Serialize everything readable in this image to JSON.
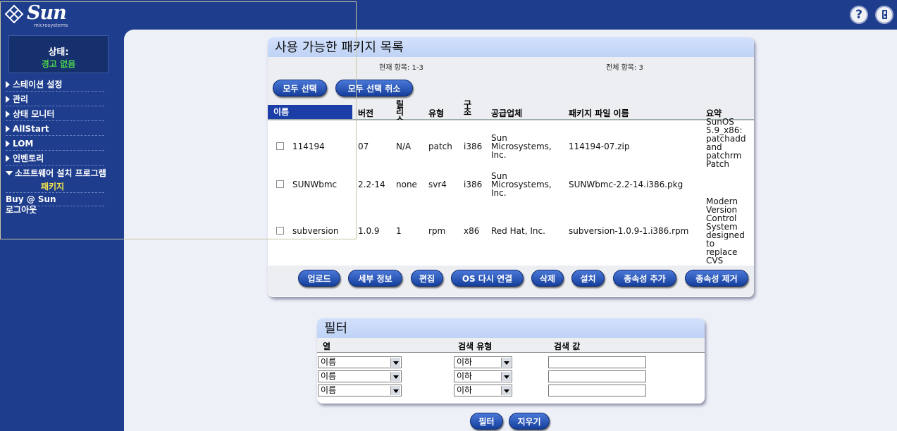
{
  "header": {
    "brand": "Sun",
    "brand_sub": "microsystems",
    "help_label": "?"
  },
  "sidebar": {
    "status_label": "상태:",
    "status_value": "경고 없음",
    "items": [
      {
        "label": "스테이션 설정"
      },
      {
        "label": "관리"
      },
      {
        "label": "상태 모니터"
      },
      {
        "label": "AllStart"
      },
      {
        "label": "LOM"
      },
      {
        "label": "인벤토리"
      },
      {
        "label": "소프트웨어 설치 프로그램"
      }
    ],
    "subitem": "패키지",
    "plain_items": [
      {
        "label": "Buy @ Sun"
      },
      {
        "label": "로그아웃"
      }
    ]
  },
  "packages": {
    "title": "사용 가능한 패키지 목록",
    "current_items": "현재 항목: 1-3",
    "total_items": "전체 항목: 3",
    "select_all": "모두 선택",
    "deselect_all": "모두 선택 취소",
    "columns": {
      "name": "이름",
      "version": "버전",
      "release": "릴리스",
      "type": "유형",
      "arch": "구조",
      "vendor": "공급업체",
      "file": "패키지 파일 이름",
      "summary": "요약"
    },
    "rows": [
      {
        "name": "114194",
        "version": "07",
        "release": "N/A",
        "type": "patch",
        "arch": "i386",
        "vendor": [
          "Sun",
          "Microsystems,",
          "Inc."
        ],
        "file": "114194-07.zip",
        "summary": [
          "SunOS",
          "5.9_x86:",
          "patchadd",
          "and",
          "patchrm",
          "Patch"
        ]
      },
      {
        "name": "SUNWbmc",
        "version": "2.2-14",
        "release": "none",
        "type": "svr4",
        "arch": "i386",
        "vendor": [
          "Sun",
          "Microsystems,",
          "Inc."
        ],
        "file": "SUNWbmc-2.2-14.i386.pkg",
        "summary": []
      },
      {
        "name": "subversion",
        "version": "1.0.9",
        "release": "1",
        "type": "rpm",
        "arch": "x86",
        "vendor": [
          "Red Hat, Inc."
        ],
        "file": "subversion-1.0.9-1.i386.rpm",
        "summary": [
          "Modern",
          "Version",
          "Control",
          "System",
          "designed",
          "to",
          "replace",
          "CVS"
        ]
      }
    ],
    "actions": {
      "upload": "업로드",
      "details": "세부 정보",
      "edit": "편집",
      "os_relink": "OS 다시 연결",
      "delete": "삭제",
      "install": "설치",
      "add_dep": "종속성 추가",
      "remove_dep": "종속성 제거"
    }
  },
  "filter": {
    "title": "필터",
    "col_header": "열",
    "type_header": "검색 유형",
    "value_header": "검색 값",
    "rows": [
      {
        "column": "이름",
        "search_type": "이하",
        "value": ""
      },
      {
        "column": "이름",
        "search_type": "이하",
        "value": ""
      },
      {
        "column": "이름",
        "search_type": "이하",
        "value": ""
      }
    ],
    "apply": "필터",
    "clear": "지우기"
  }
}
